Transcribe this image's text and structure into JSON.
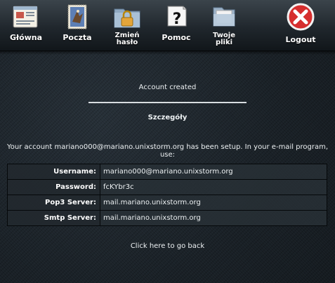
{
  "toolbar": {
    "items": [
      {
        "label": "Główna",
        "icon": "home-window-icon"
      },
      {
        "label": "Poczta",
        "icon": "stamp-mail-icon"
      },
      {
        "label": "Zmień\nhasło",
        "icon": "locked-folder-icon"
      },
      {
        "label": "Pomoc",
        "icon": "help-question-icon"
      },
      {
        "label": "Twoje\npliki",
        "icon": "files-folder-icon"
      },
      {
        "label": "Logout",
        "icon": "logout-x-icon"
      }
    ]
  },
  "main": {
    "status": "Account created",
    "section_title": "Szczegóły",
    "intro": "Your account mariano000@mariano.unixstorm.org has been setup. In your e-mail program, use:",
    "details": [
      {
        "key": "Username:",
        "value": "mariano000@mariano.unixstorm.org"
      },
      {
        "key": "Password:",
        "value": "fcKYbr3c"
      },
      {
        "key": "Pop3 Server:",
        "value": "mail.mariano.unixstorm.org"
      },
      {
        "key": "Smtp Server:",
        "value": "mail.mariano.unixstorm.org"
      }
    ],
    "back_link": "Click here to go back"
  }
}
